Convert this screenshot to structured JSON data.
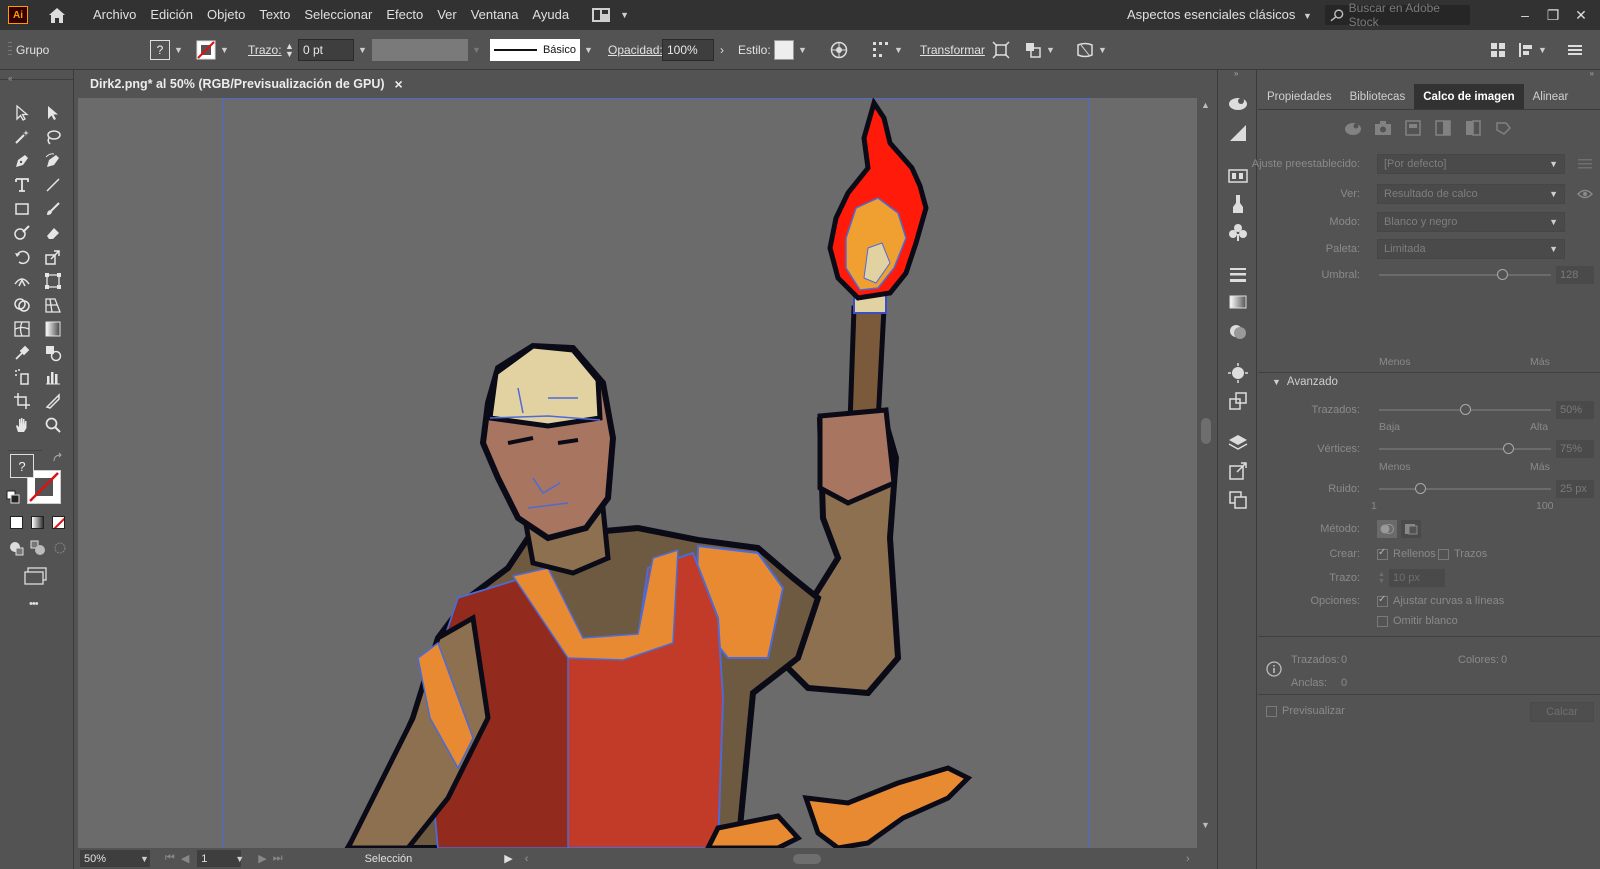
{
  "menubar": {
    "logo": "Ai",
    "items": [
      "Archivo",
      "Edición",
      "Objeto",
      "Texto",
      "Seleccionar",
      "Efecto",
      "Ver",
      "Ventana",
      "Ayuda"
    ],
    "workspace": "Aspectos esenciales clásicos",
    "search_placeholder": "Buscar en Adobe Stock"
  },
  "controlbar": {
    "selection_type": "Grupo",
    "fill_glyph": "?",
    "stroke_label": "Trazo:",
    "stroke_value": "0 pt",
    "brush_label": "Básico",
    "opacity_label": "Opacidad:",
    "opacity_value": "100%",
    "style_label": "Estilo:",
    "transform_label": "Transformar"
  },
  "document": {
    "tab_title": "Dirk2.png* al 50% (RGB/Previsualización de GPU)",
    "close": "×"
  },
  "status": {
    "zoom": "50%",
    "artboard": "1",
    "tool": "Selección"
  },
  "tools_panel": {
    "more": "•••",
    "fill_glyph": "?"
  },
  "panel": {
    "tabs": [
      "Propiedades",
      "Bibliotecas",
      "Calco de imagen",
      "Alinear"
    ],
    "active_tab": 2,
    "preset_label": "Ajuste preestablecido:",
    "preset_value": "[Por defecto]",
    "view_label": "Ver:",
    "view_value": "Resultado de calco",
    "mode_label": "Modo:",
    "mode_value": "Blanco y negro",
    "palette_label": "Paleta:",
    "palette_value": "Limitada",
    "threshold_label": "Umbral:",
    "threshold_value": "128",
    "threshold_fraction": 0.72,
    "less": "Menos",
    "more": "Más",
    "advanced_label": "Avanzado",
    "paths_label": "Trazados:",
    "paths_value": "50%",
    "paths_fraction": 0.5,
    "low": "Baja",
    "high": "Alta",
    "corners_label": "Vértices:",
    "corners_value": "75%",
    "corners_fraction": 0.75,
    "noise_label": "Ruido:",
    "noise_value": "25 px",
    "noise_fraction": 0.24,
    "noise_min": "1",
    "noise_max": "100",
    "method_label": "Método:",
    "create_label": "Crear:",
    "fills_label": "Rellenos",
    "fills_checked": true,
    "strokes_label": "Trazos",
    "strokes_checked": false,
    "stroke_label": "Trazo:",
    "stroke_value": "10 px",
    "options_label": "Opciones:",
    "snap_label": "Ajustar curvas a líneas",
    "snap_checked": true,
    "ignore_white_label": "Omitir blanco",
    "ignore_white_checked": false,
    "paths_count_label": "Trazados:",
    "paths_count": "0",
    "colors_label": "Colores:",
    "colors_count": "0",
    "anchors_label": "Anclas:",
    "anchors_count": "0",
    "preview_label": "Previsualizar",
    "trace_button": "Calcar"
  },
  "colors": {
    "ui_dark": "#323232",
    "ui_mid": "#535353",
    "canvas": "#6b6b6b",
    "selection_blue": "#4d6bd6",
    "flame_red": "#ff1a0a",
    "flame_orange": "#f0a030",
    "tunic_red": "#c23a28",
    "tunic_dark": "#922a1e",
    "orange": "#e88a32",
    "skin": "#a87560",
    "hat": "#e2d2a2",
    "olive": "#6e5a40",
    "tan": "#8c7050"
  }
}
